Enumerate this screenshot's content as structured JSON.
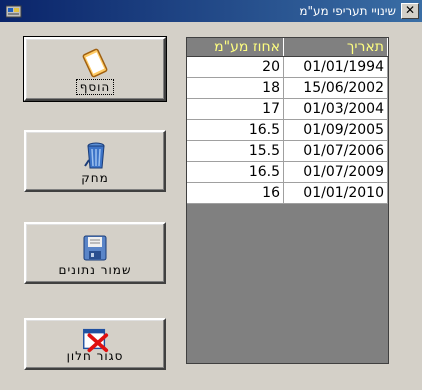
{
  "window": {
    "title": "שינויי תעריפי מע\"מ"
  },
  "icons": {
    "app": "app-icon",
    "close": "close-icon"
  },
  "buttons": {
    "add": {
      "label": "הוסף",
      "icon": "notepad-icon"
    },
    "delete": {
      "label": "מחק",
      "icon": "trash-can-icon"
    },
    "save": {
      "label": "שמור נתונים",
      "icon": "floppy-disk-icon"
    },
    "close": {
      "label": "סגור חלון",
      "icon": "close-window-icon"
    }
  },
  "grid": {
    "columns": [
      "תאריך",
      "אחוז מע\"מ"
    ],
    "rows": [
      {
        "date": "01/01/1994",
        "pct": "20"
      },
      {
        "date": "15/06/2002",
        "pct": "18"
      },
      {
        "date": "01/03/2004",
        "pct": "17"
      },
      {
        "date": "01/09/2005",
        "pct": "16.5"
      },
      {
        "date": "01/07/2006",
        "pct": "15.5"
      },
      {
        "date": "01/07/2009",
        "pct": "16.5"
      },
      {
        "date": "01/01/2010",
        "pct": "16"
      }
    ]
  }
}
